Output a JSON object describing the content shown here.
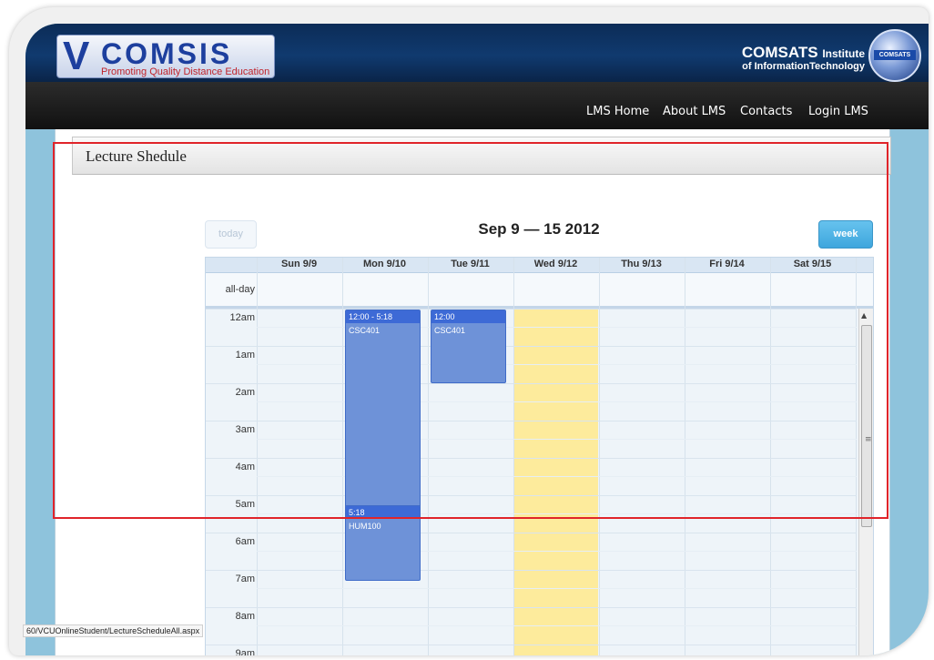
{
  "branding": {
    "logo_mark": "V",
    "logo_word": "COMSIS",
    "logo_tagline": "Promoting Quality Distance Education",
    "institute_name": "COMSATS",
    "institute_name_suffix": "Institute",
    "institute_subtitle": "of InformationTechnology",
    "seal_text": "COMSATS"
  },
  "nav": {
    "items": [
      {
        "label": "LMS Home"
      },
      {
        "label": "About LMS"
      },
      {
        "label": "Contacts"
      },
      {
        "label": "Login LMS"
      }
    ]
  },
  "panel": {
    "title": "Lecture Shedule"
  },
  "calendar": {
    "range_title": "Sep 9 — 15 2012",
    "today_button": "today",
    "view_button": "week",
    "days": [
      "Sun 9/9",
      "Mon 9/10",
      "Tue 9/11",
      "Wed 9/12",
      "Thu 9/13",
      "Fri 9/14",
      "Sat 9/15"
    ],
    "today_day": "Wed 9/12",
    "all_day_label": "all-day",
    "hours": [
      "12am",
      "1am",
      "2am",
      "3am",
      "4am",
      "5am",
      "6am",
      "7am",
      "8am",
      "9am"
    ],
    "events": [
      {
        "day": "Mon 9/10",
        "time": "12:00 - 5:18",
        "title": "CSC401"
      },
      {
        "day": "Tue 9/11",
        "time": "12:00",
        "title": "CSC401"
      },
      {
        "day": "Mon 9/10",
        "time": "5:18",
        "title": "HUM100"
      }
    ]
  },
  "status_bar": {
    "url": "60/VCUOnlineStudent/LectureScheduleAll.aspx"
  },
  "colors": {
    "banner": "#0c2c57",
    "nav_bar": "#1a1a1a",
    "page_bg": "#8ec3dc",
    "today_highlight": "#fdeb9c",
    "event_body": "#6e92d8",
    "event_header": "#3d6ad6",
    "week_button": "#3ea6dd",
    "annotation_box": "#e0242a"
  },
  "icons": {
    "scroll_up": "triangle-up-icon",
    "scroll_grip": "grip-icon"
  }
}
